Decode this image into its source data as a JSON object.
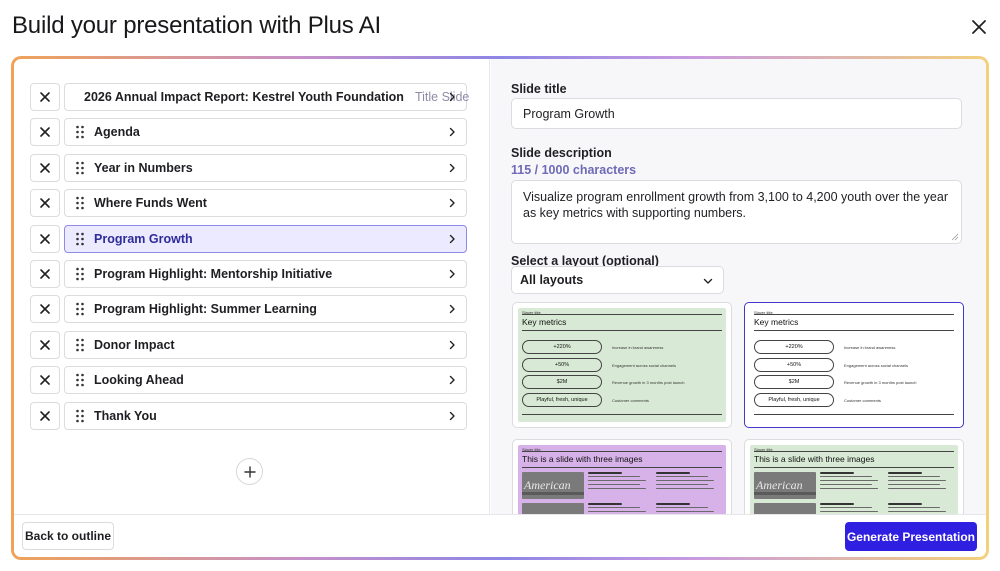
{
  "header": {
    "title": "Build your presentation with Plus AI",
    "close_icon": "close-icon"
  },
  "colors": {
    "accent": "#2f1fe0",
    "selected_bg": "#ebeaff",
    "selected_border": "#8f8ae8"
  },
  "slides": [
    {
      "label": "2026 Annual Impact Report: Kestrel Youth Foundation",
      "tag": "Title Slide",
      "selected": false
    },
    {
      "label": "Agenda",
      "tag": "",
      "selected": false
    },
    {
      "label": "Year in Numbers",
      "tag": "",
      "selected": false
    },
    {
      "label": "Where Funds Went",
      "tag": "",
      "selected": false
    },
    {
      "label": "Program Growth",
      "tag": "",
      "selected": true
    },
    {
      "label": "Program Highlight: Mentorship Initiative",
      "tag": "",
      "selected": false
    },
    {
      "label": "Program Highlight: Summer Learning",
      "tag": "",
      "selected": false
    },
    {
      "label": "Donor Impact",
      "tag": "",
      "selected": false
    },
    {
      "label": "Looking Ahead",
      "tag": "",
      "selected": false
    },
    {
      "label": "Thank You",
      "tag": "",
      "selected": false
    }
  ],
  "editor": {
    "title_label": "Slide title",
    "title_value": "Program Growth",
    "description_label": "Slide description",
    "char_count": "115 / 1000 characters",
    "description_value": "Visualize program enrollment growth from 3,100 to 4,200 youth over the year as key metrics with supporting numbers.",
    "layout_label": "Select a layout (optional)",
    "layout_select_value": "All layouts"
  },
  "layouts": [
    {
      "kicker": "Slayer title",
      "title": "Key metrics",
      "style": "green",
      "selected": false,
      "metrics": [
        "+220%",
        "+50%",
        "$2M",
        "Playful, fresh, unique"
      ],
      "descriptions": [
        "Increase in brand awareness",
        "Engagement across social channels",
        "Revenue growth in 3 months post launch",
        "Customer comments"
      ]
    },
    {
      "kicker": "Slayer title",
      "title": "Key metrics",
      "style": "white",
      "selected": true,
      "metrics": [
        "+220%",
        "+50%",
        "$2M",
        "Playful, fresh, unique"
      ],
      "descriptions": [
        "Increase in brand awareness",
        "Engagement across social channels",
        "Revenue growth in 3 months post launch",
        "Customer comments"
      ]
    },
    {
      "kicker": "Slayer title",
      "title": "This is a slide with three images",
      "style": "purple",
      "selected": false,
      "image_word": "American"
    },
    {
      "kicker": "Slayer title",
      "title": "This is a slide with three images",
      "style": "green",
      "selected": false,
      "image_word": "American"
    }
  ],
  "footer": {
    "back_label": "Back to outline",
    "generate_label": "Generate Presentation"
  }
}
